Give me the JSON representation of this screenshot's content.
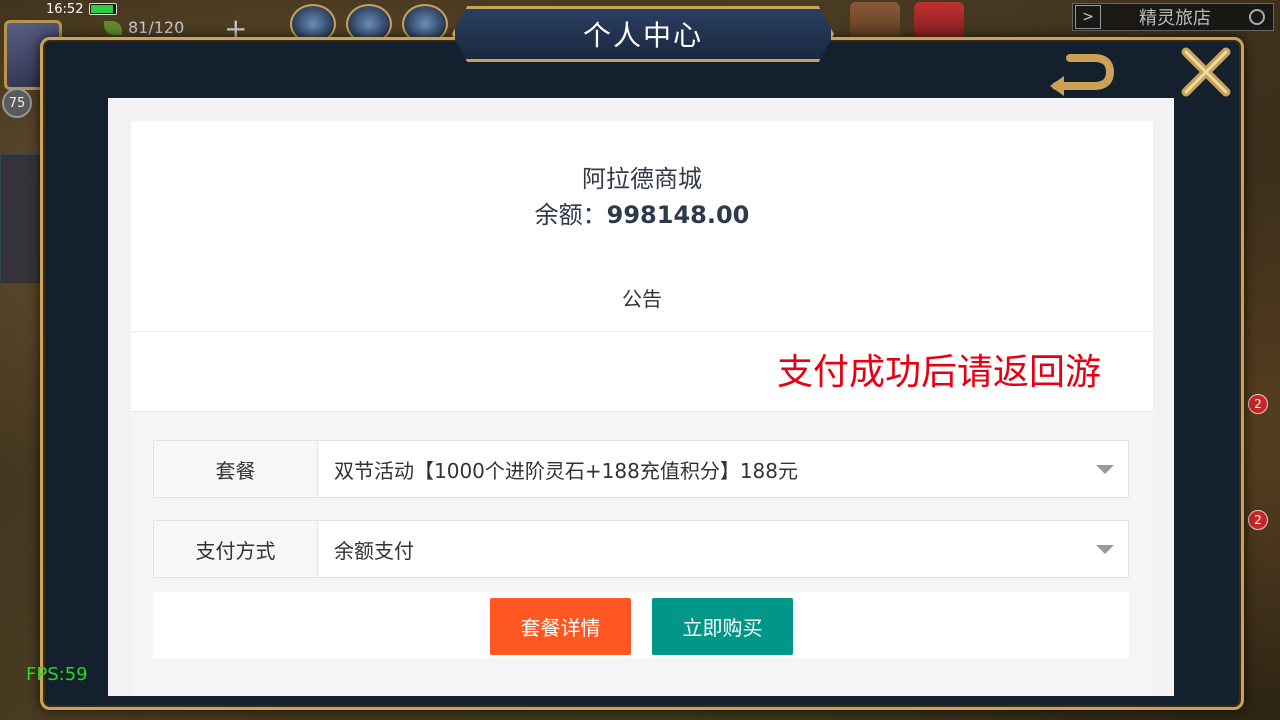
{
  "status_bar": {
    "time": "16:52"
  },
  "player": {
    "level": "75",
    "stamina": "81/120"
  },
  "top_right": {
    "shop_label": "精灵旅店"
  },
  "side_badges": [
    "2",
    "2"
  ],
  "fps": "FPS:59",
  "dialog": {
    "title": "个人中心"
  },
  "store": {
    "name": "阿拉德商城",
    "balance_label": "余额：",
    "balance_value": "998148.00",
    "notice_title": "公告",
    "notice_marquee": "支付成功后请返回游"
  },
  "form": {
    "package_label": "套餐",
    "package_value": "双节活动【1000个进阶灵石+188充值积分】188元",
    "payment_label": "支付方式",
    "payment_value": "余额支付"
  },
  "buttons": {
    "details": "套餐详情",
    "buy": "立即购买"
  },
  "colors": {
    "details_button": "#ff5722",
    "buy_button": "#009688",
    "marquee_text": "#e60012",
    "frame_gold": "#c9a35a"
  }
}
